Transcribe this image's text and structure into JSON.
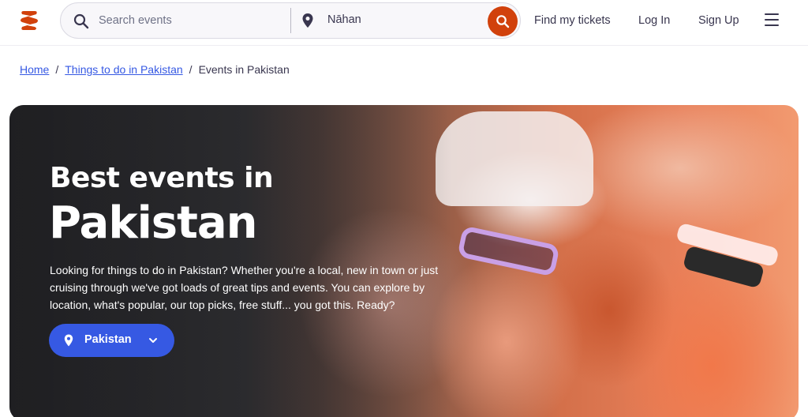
{
  "header": {
    "logo_icon": "eventbrite-logo-icon",
    "brand_color": "#d1410c",
    "search": {
      "placeholder": "Search events",
      "location_value": "Nāhan",
      "search_icon": "search-icon",
      "location_icon": "location-pin-icon",
      "submit_icon": "search-icon"
    },
    "nav": {
      "find_tickets": "Find my tickets",
      "log_in": "Log In",
      "sign_up": "Sign Up",
      "menu_icon": "hamburger-menu-icon"
    }
  },
  "breadcrumb": {
    "home": "Home",
    "separator": "/",
    "things_to_do": "Things to do in Pakistan",
    "current": "Events in Pakistan"
  },
  "hero": {
    "title_line1": "Best events in",
    "title_line2": "Pakistan",
    "description": "Looking for things to do in Pakistan? Whether you're a local, new in town or just cruising through we've got loads of great tips and events. You can explore by location, what's popular, our top picks, free stuff... you got this. Ready?",
    "location_button": {
      "label": "Pakistan",
      "icon": "location-pin-icon",
      "chevron_icon": "chevron-down-icon",
      "color": "#3659e3"
    }
  }
}
